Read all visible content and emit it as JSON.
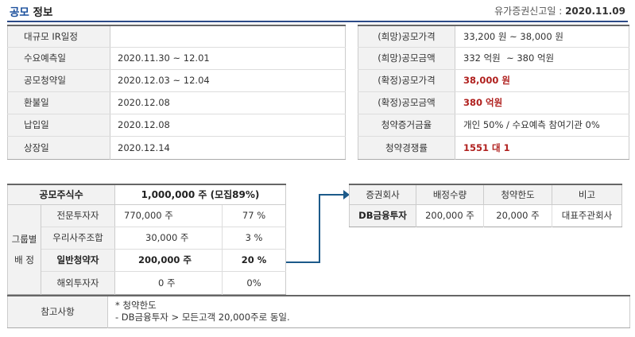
{
  "header": {
    "title_accent": "공모",
    "title_rest": " 정보",
    "filing_label": "유가증권신고일 : ",
    "filing_date": "2020.11.09"
  },
  "schedule": [
    {
      "label": "대규모 IR일정",
      "value": ""
    },
    {
      "label": "수요예측일",
      "value": "2020.11.30 ~ 12.01"
    },
    {
      "label": "공모청약일",
      "value": "2020.12.03 ~ 12.04"
    },
    {
      "label": "환불일",
      "value": "2020.12.08"
    },
    {
      "label": "납입일",
      "value": "2020.12.08"
    },
    {
      "label": "상장일",
      "value": "2020.12.14"
    }
  ],
  "pricing": [
    {
      "label": "(희망)공모가격",
      "value": "33,200 원 ~ 38,000 원"
    },
    {
      "label": "(희망)공모금액",
      "value": "332 억원  ~ 380 억원"
    },
    {
      "label": "(확정)공모가격",
      "value": "38,000 원"
    },
    {
      "label": "(확정)공모금액",
      "value": "380 억원"
    },
    {
      "label": "청약증거금율",
      "value": "개인 50% / 수요예측 참여기관 0%"
    },
    {
      "label": "청약경쟁률",
      "value": "1551 대 1"
    }
  ],
  "allocation": {
    "total_label": "공모주식수",
    "total_value": "1,000,000 주 (모집89%)",
    "group_label_1": "그룹별",
    "group_label_2": "배 정",
    "rows": [
      {
        "name": "전문투자자",
        "shares": "770,000 주",
        "pct": "77 %"
      },
      {
        "name": "우리사주조합",
        "shares": "30,000 주",
        "pct": "3 %"
      },
      {
        "name": "일반청약자",
        "shares": "200,000 주",
        "pct": "20 %"
      },
      {
        "name": "해외투자자",
        "shares": "0 주",
        "pct": "0%"
      }
    ]
  },
  "underwriters": {
    "headers": [
      "증권회사",
      "배정수량",
      "청약한도",
      "비고"
    ],
    "rows": [
      {
        "company": "DB금융투자",
        "shares": "200,000 주",
        "limit": "20,000 주",
        "note": "대표주관회사"
      }
    ]
  },
  "notes": {
    "label": "참고사항",
    "line1": "* 청약한도",
    "line2": "- DB금융투자 > 모든고객 20,000주로 동일."
  },
  "colors": {
    "header_rule": "#2d4b88",
    "accent_blue": "#1a4f9c",
    "highlight_red": "#b0201e",
    "arrow": "#1c5a8a",
    "label_bg": "#f2f2f2"
  }
}
